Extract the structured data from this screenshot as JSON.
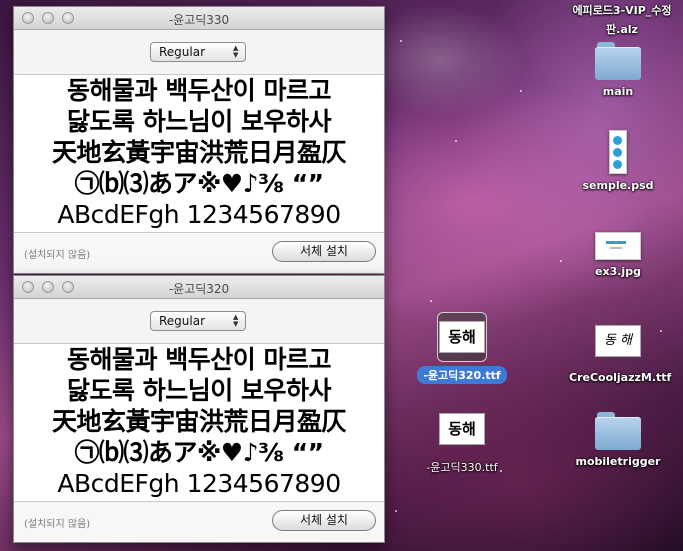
{
  "windows": [
    {
      "title": "-윤고딕330",
      "style_value": "Regular",
      "preview_lines": [
        "동해물과 백두산이 마르고",
        "닳도록 하느님이 보우하사",
        "天地玄黃宇宙洪荒日月盈仄",
        "㉠⒝⑶あア※♥♪⅜ “”",
        "ABcdEFgh 1234567890"
      ],
      "status": "(설치되지 않음)",
      "install_label": "서체 설치"
    },
    {
      "title": "-윤고딕320",
      "style_value": "Regular",
      "preview_lines": [
        "동해물과 백두산이 마르고",
        "닳도록 하느님이 보우하사",
        "天地玄黃宇宙洪荒日月盈仄",
        "㉠⒝⑶あア※♥♪⅜ “”",
        "ABcdEFgh 1234567890"
      ],
      "status": "(설치되지 않음)",
      "install_label": "서체 설치"
    }
  ],
  "desktop": {
    "alz_label_line1": "에피로드3-VIP_수정",
    "alz_label_line2": "판.alz",
    "items": [
      {
        "label": "main",
        "kind": "folder"
      },
      {
        "label": "semple.psd",
        "kind": "image"
      },
      {
        "label": "ex3.jpg",
        "kind": "image"
      },
      {
        "label": "CreCooljazzM.ttf",
        "kind": "font",
        "thumb_text": "동 해"
      },
      {
        "label": "mobiletrigger",
        "kind": "folder"
      },
      {
        "label": "-윤고딕320.ttf",
        "kind": "font",
        "thumb_text": "동해",
        "selected": true
      },
      {
        "label": "-윤고딕330.ttf",
        "kind": "font",
        "thumb_text": "동해"
      }
    ]
  }
}
